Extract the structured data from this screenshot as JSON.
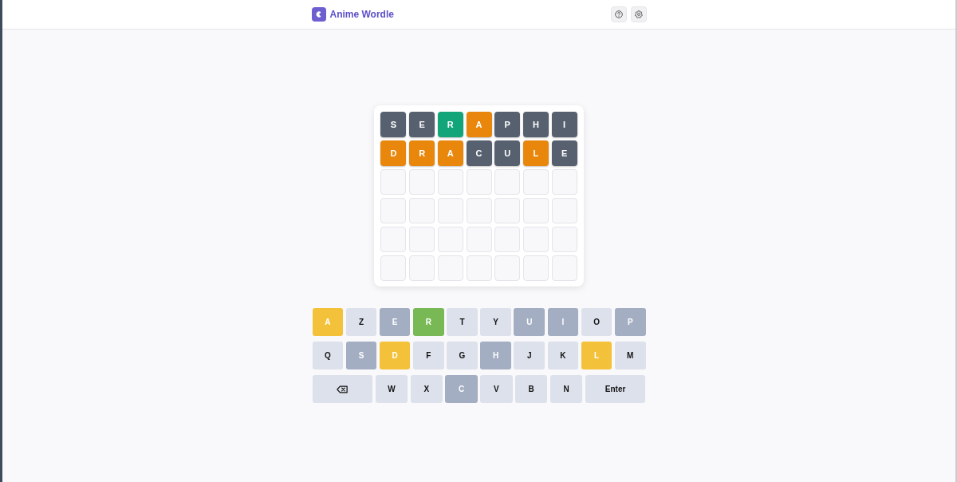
{
  "header": {
    "title": "Anime Wordle",
    "actions": [
      {
        "kind": "help"
      },
      {
        "kind": "settings"
      }
    ]
  },
  "board": {
    "rows": [
      {
        "tiles": [
          {
            "kind": "letter",
            "letter": "S",
            "color": "#56606f"
          },
          {
            "kind": "letter",
            "letter": "E",
            "color": "#56606f"
          },
          {
            "kind": "letter",
            "letter": "R",
            "color": "#12a57a"
          },
          {
            "kind": "letter",
            "letter": "A",
            "color": "#e8870c"
          },
          {
            "kind": "letter",
            "letter": "P",
            "color": "#56606f"
          },
          {
            "kind": "letter",
            "letter": "H",
            "color": "#56606f"
          },
          {
            "kind": "letter",
            "letter": "I",
            "color": "#56606f"
          }
        ]
      },
      {
        "tiles": [
          {
            "kind": "letter",
            "letter": "D",
            "color": "#e8870c"
          },
          {
            "kind": "letter",
            "letter": "R",
            "color": "#e8870c"
          },
          {
            "kind": "letter",
            "letter": "A",
            "color": "#e8870c"
          },
          {
            "kind": "letter",
            "letter": "C",
            "color": "#56606f"
          },
          {
            "kind": "letter",
            "letter": "U",
            "color": "#56606f"
          },
          {
            "kind": "letter",
            "letter": "L",
            "color": "#e8870c"
          },
          {
            "kind": "letter",
            "letter": "E",
            "color": "#56606f"
          }
        ]
      },
      {
        "tiles": [
          {
            "kind": "empty"
          },
          {
            "kind": "empty"
          },
          {
            "kind": "empty"
          },
          {
            "kind": "empty"
          },
          {
            "kind": "empty"
          },
          {
            "kind": "empty"
          },
          {
            "kind": "empty"
          }
        ]
      },
      {
        "tiles": [
          {
            "kind": "empty"
          },
          {
            "kind": "empty"
          },
          {
            "kind": "empty"
          },
          {
            "kind": "empty"
          },
          {
            "kind": "empty"
          },
          {
            "kind": "empty"
          },
          {
            "kind": "empty"
          }
        ]
      },
      {
        "tiles": [
          {
            "kind": "empty"
          },
          {
            "kind": "empty"
          },
          {
            "kind": "empty"
          },
          {
            "kind": "empty"
          },
          {
            "kind": "empty"
          },
          {
            "kind": "empty"
          },
          {
            "kind": "empty"
          }
        ]
      },
      {
        "tiles": [
          {
            "kind": "empty"
          },
          {
            "kind": "empty"
          },
          {
            "kind": "empty"
          },
          {
            "kind": "empty"
          },
          {
            "kind": "empty"
          },
          {
            "kind": "empty"
          },
          {
            "kind": "empty"
          }
        ]
      }
    ]
  },
  "keyboard": {
    "rows": [
      {
        "keys": [
          {
            "kind": "letter",
            "label": "A",
            "color": "#f3c23a"
          },
          {
            "kind": "letter",
            "label": "Z",
            "color": "#dde1ec"
          },
          {
            "kind": "letter",
            "label": "E",
            "color": "#a3aec2"
          },
          {
            "kind": "letter",
            "label": "R",
            "color": "#79b955"
          },
          {
            "kind": "letter",
            "label": "T",
            "color": "#dde1ec"
          },
          {
            "kind": "letter",
            "label": "Y",
            "color": "#dde1ec"
          },
          {
            "kind": "letter",
            "label": "U",
            "color": "#a3aec2"
          },
          {
            "kind": "letter",
            "label": "I",
            "color": "#a3aec2"
          },
          {
            "kind": "letter",
            "label": "O",
            "color": "#dde1ec"
          },
          {
            "kind": "letter",
            "label": "P",
            "color": "#a3aec2"
          }
        ]
      },
      {
        "keys": [
          {
            "kind": "letter",
            "label": "Q",
            "color": "#dde1ec"
          },
          {
            "kind": "letter",
            "label": "S",
            "color": "#a3aec2"
          },
          {
            "kind": "letter",
            "label": "D",
            "color": "#f3c23a"
          },
          {
            "kind": "letter",
            "label": "F",
            "color": "#dde1ec"
          },
          {
            "kind": "letter",
            "label": "G",
            "color": "#dde1ec"
          },
          {
            "kind": "letter",
            "label": "H",
            "color": "#a3aec2"
          },
          {
            "kind": "letter",
            "label": "J",
            "color": "#dde1ec"
          },
          {
            "kind": "letter",
            "label": "K",
            "color": "#dde1ec"
          },
          {
            "kind": "letter",
            "label": "L",
            "color": "#f3c23a"
          },
          {
            "kind": "letter",
            "label": "M",
            "color": "#dde1ec"
          }
        ]
      },
      {
        "keys": [
          {
            "kind": "backspace",
            "color": "#dde1ec"
          },
          {
            "kind": "letter",
            "label": "W",
            "color": "#dde1ec"
          },
          {
            "kind": "letter",
            "label": "X",
            "color": "#dde1ec"
          },
          {
            "kind": "letter",
            "label": "C",
            "color": "#a3aec2"
          },
          {
            "kind": "letter",
            "label": "V",
            "color": "#dde1ec"
          },
          {
            "kind": "letter",
            "label": "B",
            "color": "#dde1ec"
          },
          {
            "kind": "letter",
            "label": "N",
            "color": "#dde1ec"
          },
          {
            "kind": "enter",
            "label": "Enter",
            "color": "#dde1ec"
          }
        ]
      }
    ]
  }
}
